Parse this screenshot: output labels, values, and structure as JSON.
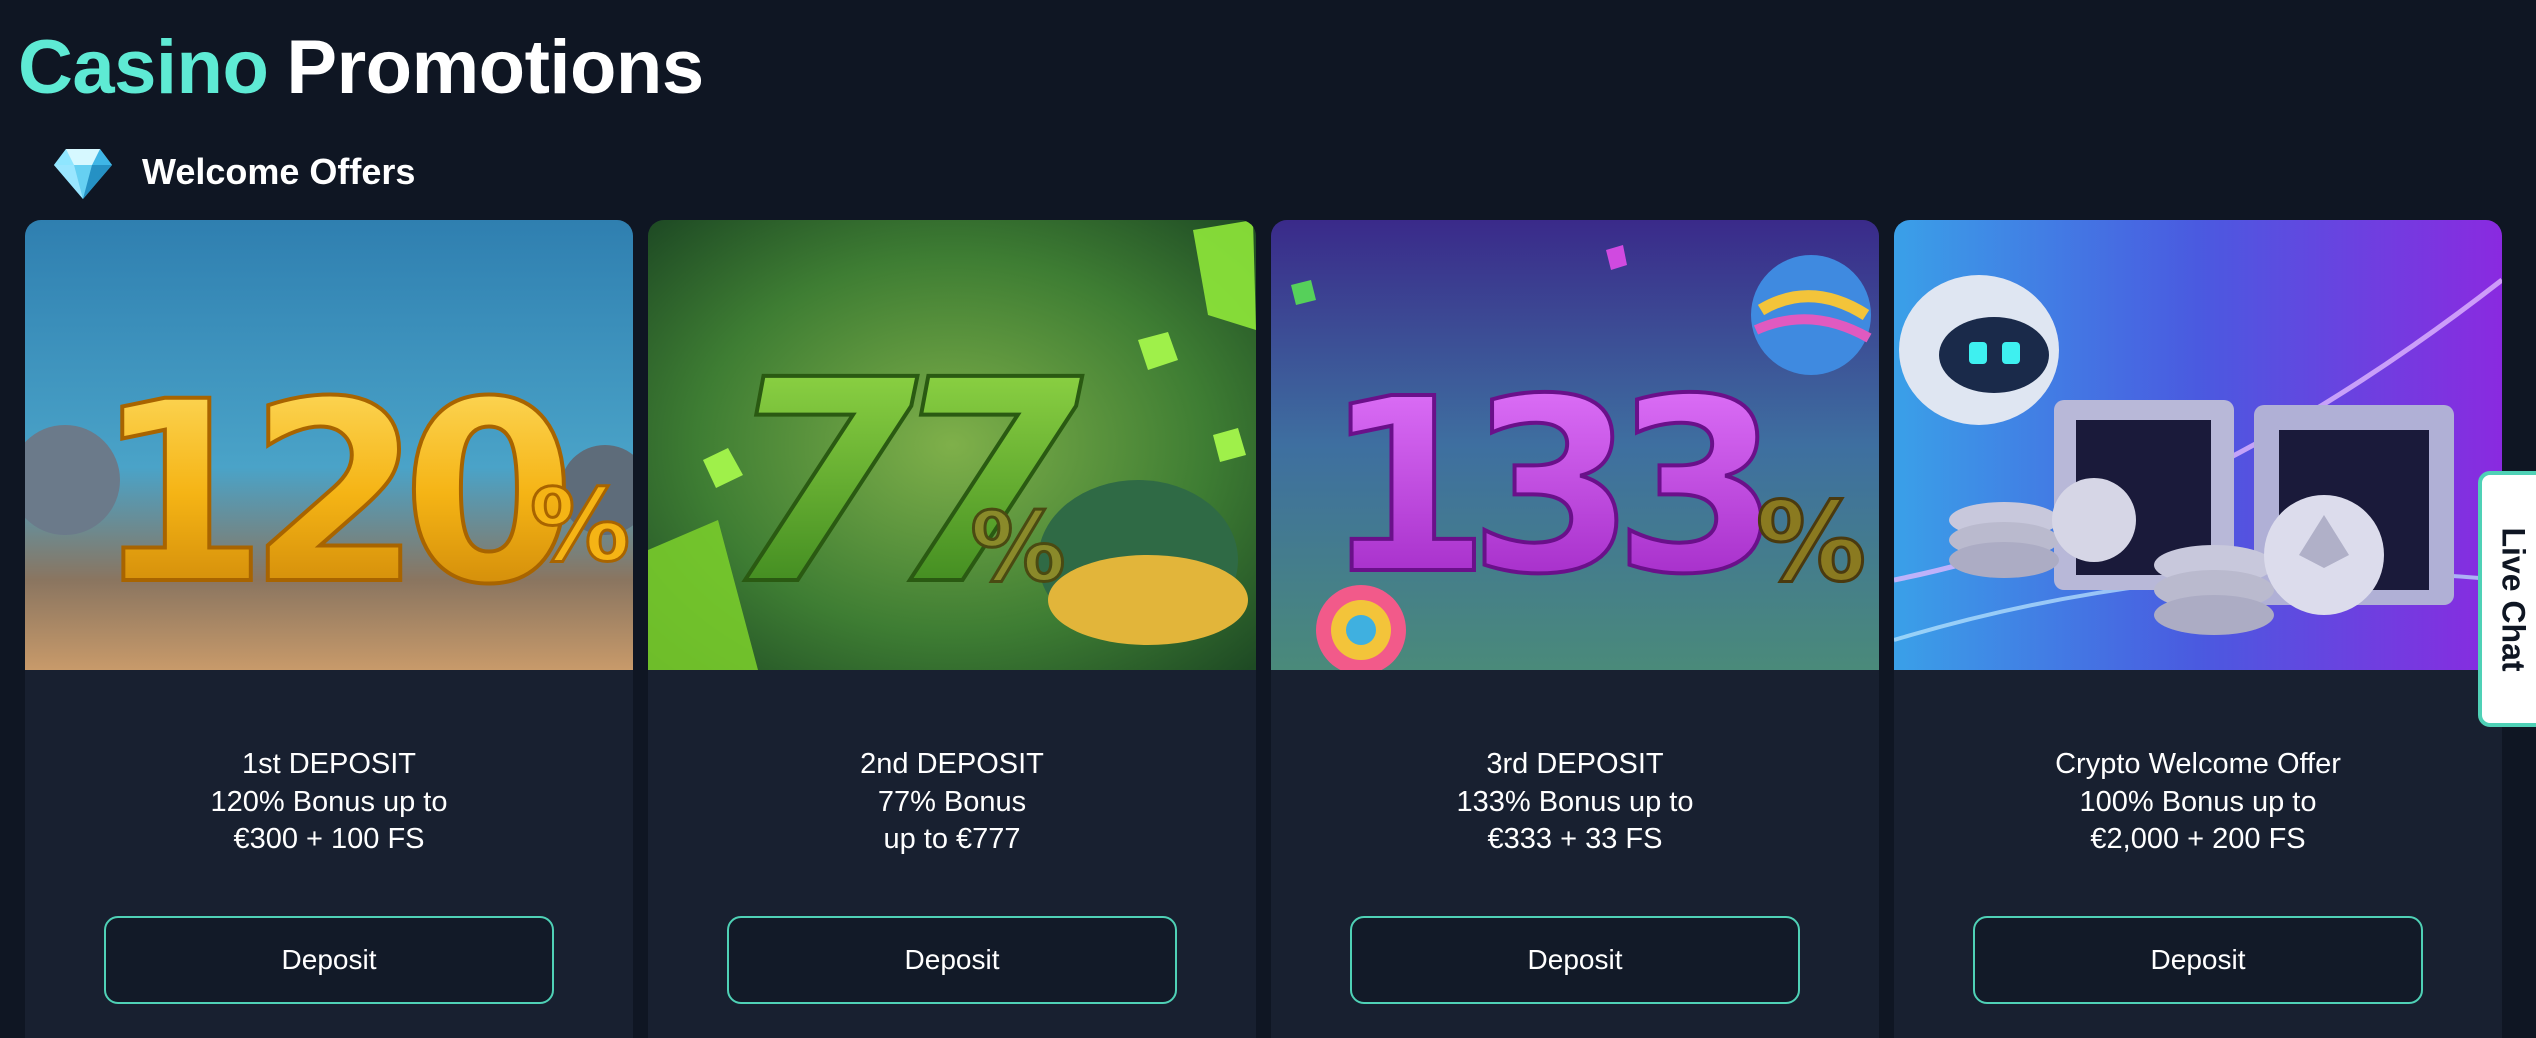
{
  "page": {
    "title_accent": "Casino",
    "title_main": "Promotions"
  },
  "section": {
    "title": "Welcome Offers",
    "icon": "diamond-icon"
  },
  "cards": [
    {
      "art_number": "120",
      "art_percent": "%",
      "lines": [
        "1st DEPOSIT",
        "120% Bonus up to",
        "€300 + 100 FS"
      ],
      "button_label": "Deposit",
      "accent_color": "#f5b415"
    },
    {
      "art_number": "77",
      "art_percent": "%",
      "lines": [
        "2nd DEPOSIT",
        "77% Bonus",
        "up to €777"
      ],
      "button_label": "Deposit",
      "accent_color": "#5fae22"
    },
    {
      "art_number": "133",
      "art_percent": "%",
      "lines": [
        "3rd DEPOSIT",
        "133% Bonus up to",
        "€333 + 33 FS"
      ],
      "button_label": "Deposit",
      "accent_color": "#c23ee0"
    },
    {
      "art_number": "",
      "art_percent": "",
      "lines": [
        "Crypto Welcome Offer",
        "100% Bonus up to",
        "€2,000 + 200 FS"
      ],
      "button_label": "Deposit",
      "accent_color": "#7b3fe4"
    }
  ],
  "live_chat": {
    "label": "Live Chat"
  },
  "colors": {
    "background": "#0f1623",
    "card": "#182030",
    "accent": "#5eead4",
    "button_border": "#4fd1b6"
  }
}
